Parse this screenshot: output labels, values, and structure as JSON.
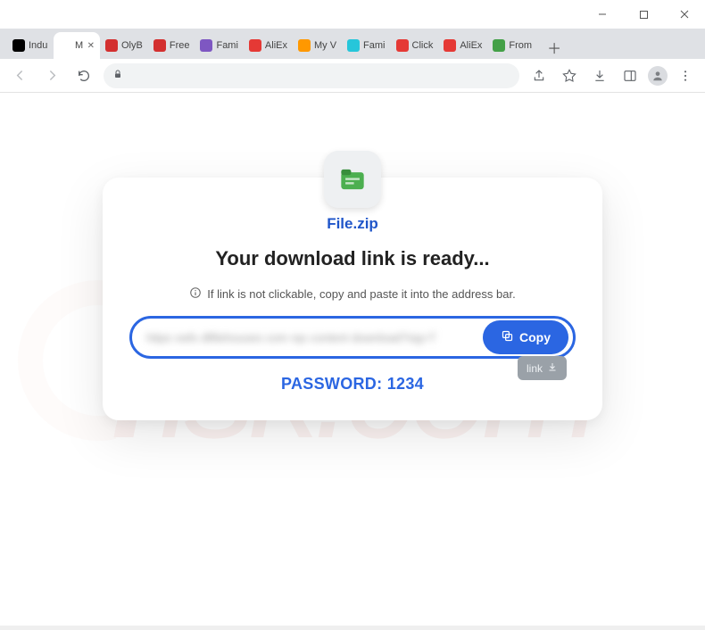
{
  "window": {
    "controls": {
      "min": "min",
      "max": "max",
      "close": "close"
    }
  },
  "tabs": [
    {
      "label": "Indu",
      "icon_bg": "#000",
      "active": false
    },
    {
      "label": "M",
      "icon_bg": "#ffffff",
      "active": true
    },
    {
      "label": "OlyB",
      "icon_bg": "#d32f2f",
      "active": false
    },
    {
      "label": "Free",
      "icon_bg": "#d32f2f",
      "active": false
    },
    {
      "label": "Fami",
      "icon_bg": "#7e57c2",
      "active": false
    },
    {
      "label": "AliEx",
      "icon_bg": "#e53935",
      "active": false
    },
    {
      "label": "My V",
      "icon_bg": "#ff9800",
      "active": false
    },
    {
      "label": "Fami",
      "icon_bg": "#26c6da",
      "active": false
    },
    {
      "label": "Click",
      "icon_bg": "#e53935",
      "active": false
    },
    {
      "label": "AliEx",
      "icon_bg": "#e53935",
      "active": false
    },
    {
      "label": "From",
      "icon_bg": "#43a047",
      "active": false
    }
  ],
  "omnibox": {
    "placeholder": ""
  },
  "content": {
    "filename": "File.zip",
    "headline": "Your download link is ready...",
    "hint": "If link is not clickable, copy and paste it into the address bar.",
    "link_display": "https vwfx dlfilehouses com rqs content download?sig=T",
    "copy_label": "Copy",
    "password_label": "PASSWORD: 1234",
    "tooltip_label": "link"
  }
}
